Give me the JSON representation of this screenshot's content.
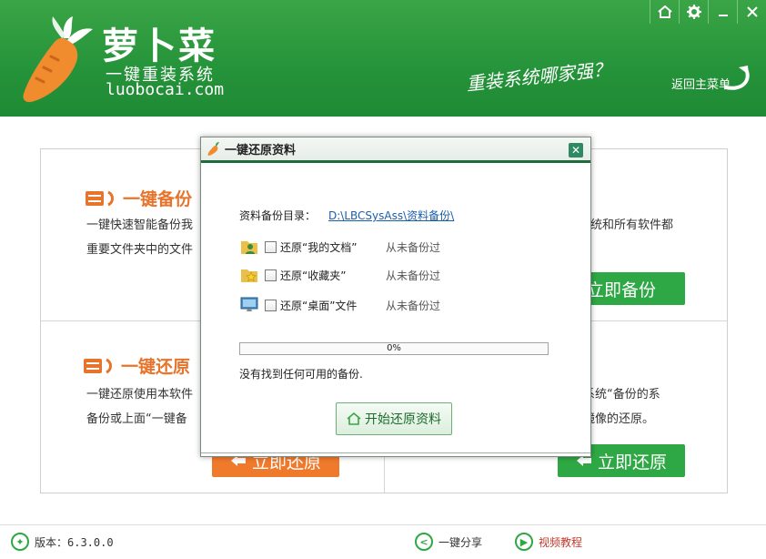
{
  "app": {
    "brand_name": "萝卜菜",
    "brand_sub": "一键重装系统",
    "brand_url": "luobocai.com",
    "slogan": "重装系统哪家强？",
    "back_main_label": "返回主菜单"
  },
  "colors": {
    "header_green": "#2a9a3d",
    "accent_orange": "#f07a2c",
    "button_green": "#2ea844",
    "dialog_border": "#1f6a3f"
  },
  "window_controls": [
    "home-icon",
    "gear-icon",
    "minimize-icon",
    "close-icon"
  ],
  "panels": {
    "backup": {
      "title": "一键备份",
      "line1": "一键快速智能备份我",
      "line2": "重要文件夹中的文件",
      "line1_right": "统和所有软件都",
      "button_label": "立即备份"
    },
    "restore": {
      "title": "一键还原",
      "line1": "一键还原使用本软件",
      "line2": "备份或上面“一键备",
      "line1_right": "系统“备份的系",
      "line2_right": "镜像的还原。",
      "button_orange_label": "立即还原",
      "button_green_label": "立即还原"
    }
  },
  "dialog": {
    "title": "一键还原资料",
    "backup_dir_label": "资料备份目录：",
    "backup_dir_path": "D:\\LBCSysAss\\资料备份\\",
    "items": [
      {
        "label": "还原“我的文档”",
        "status": "从未备份过",
        "icon": "user-folder-icon"
      },
      {
        "label": "还原“收藏夹”",
        "status": "从未备份过",
        "icon": "star-folder-icon"
      },
      {
        "label": "还原“桌面”文件",
        "status": "从未备份过",
        "icon": "desktop-icon"
      }
    ],
    "progress": {
      "value": 0,
      "text": "0%"
    },
    "message": "没有找到任何可用的备份.",
    "start_button_label": "开始还原资料"
  },
  "footer": {
    "version": "版本：6.3.0.0",
    "share": "一键分享",
    "tutorial": "视频教程"
  }
}
